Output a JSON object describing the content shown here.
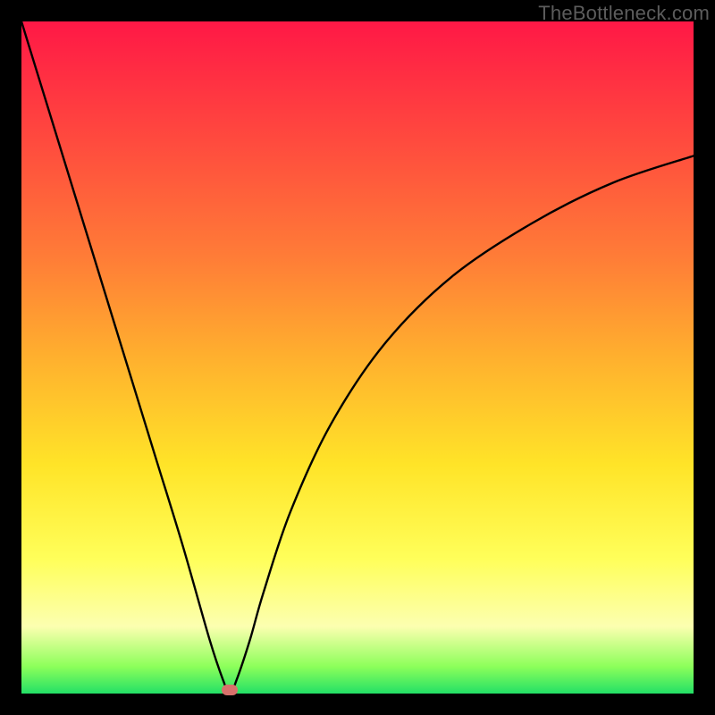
{
  "watermark": "TheBottleneck.com",
  "colors": {
    "frame": "#000000",
    "dot": "#d8706b",
    "curve": "#000000",
    "gradient_top": "#ff1846",
    "gradient_bottom": "#23e066"
  },
  "chart_data": {
    "type": "line",
    "title": "",
    "xlabel": "",
    "ylabel": "",
    "xlim": [
      0,
      100
    ],
    "ylim": [
      0,
      100
    ],
    "notes": "V-shaped bottleneck curve. Minimum (optimal match) near x≈31. Left branch descends from top-left; right branch rises asymptotically toward ~80% on the right edge. Small rounded marker at the minimum on the green band.",
    "series": [
      {
        "name": "bottleneck-curve",
        "x": [
          0,
          4,
          8,
          12,
          16,
          20,
          24,
          28,
          30,
          31,
          32,
          34,
          36,
          40,
          46,
          54,
          64,
          76,
          88,
          100
        ],
        "values": [
          100,
          87,
          74,
          61,
          48,
          35,
          22,
          8,
          2,
          0,
          2,
          8,
          15,
          27,
          40,
          52,
          62,
          70,
          76,
          80
        ]
      }
    ],
    "marker": {
      "x": 31,
      "y": 0
    }
  }
}
